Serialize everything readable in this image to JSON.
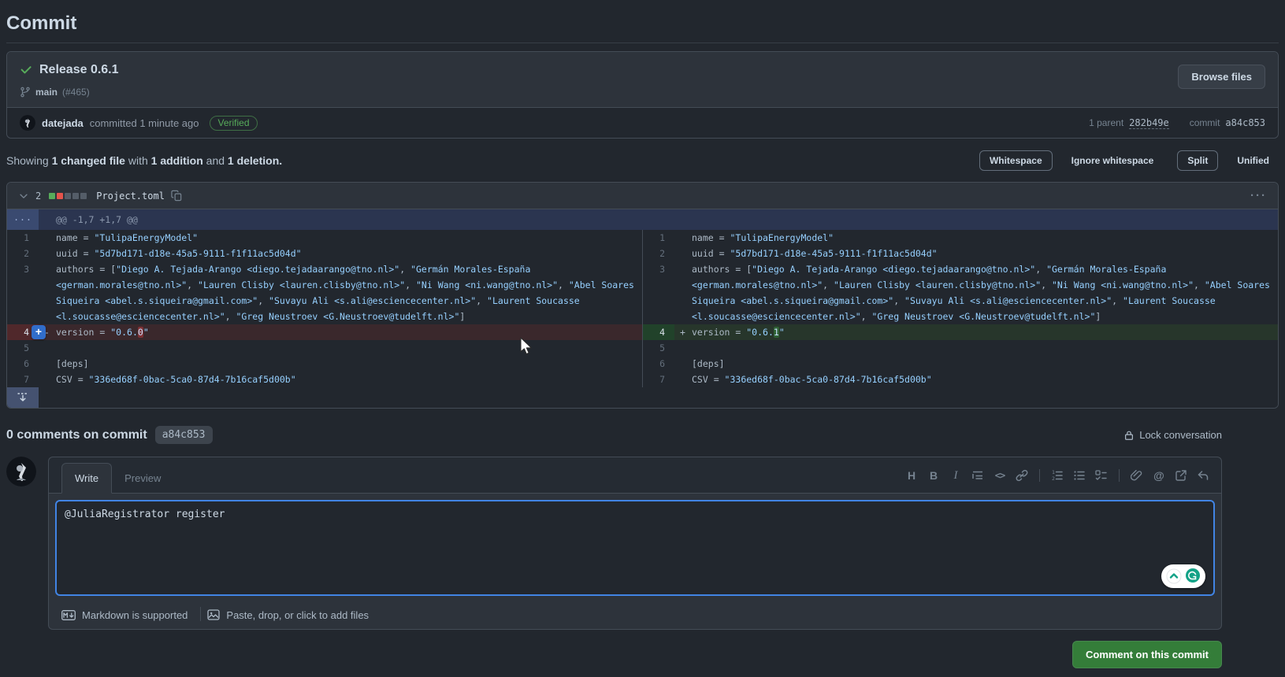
{
  "page": {
    "title": "Commit"
  },
  "commit_box": {
    "title": "Release 0.6.1",
    "branch": "main",
    "pr_ref": "(#465)",
    "browse_files_label": "Browse files",
    "author": "datejada",
    "committed_text": "committed 1 minute ago",
    "verified_label": "Verified",
    "parent_label": "1 parent",
    "parent_sha": "282b49e",
    "commit_label": "commit",
    "commit_sha": "a84c853"
  },
  "summary": {
    "showing": "Showing ",
    "changed_file": "1 changed file",
    "with": " with ",
    "addition": "1 addition",
    "and": " and ",
    "deletion": "1 deletion."
  },
  "diff_controls": {
    "whitespace": "Whitespace",
    "ignore_whitespace": "Ignore whitespace",
    "split": "Split",
    "unified": "Unified"
  },
  "file": {
    "changes_count": "2",
    "name": "Project.toml",
    "kebab": "···",
    "diffstat": [
      "add",
      "del",
      "neutral",
      "neutral",
      "neutral"
    ]
  },
  "diff": {
    "gutter_dots": "···",
    "hunk_header": "@@ -1,7 +1,7 @@",
    "rows": [
      {
        "num": "1",
        "type": "ctx",
        "segs": [
          {
            "t": "name = ",
            "c": "p"
          },
          {
            "t": "\"TulipaEnergyModel\"",
            "c": "s"
          }
        ]
      },
      {
        "num": "2",
        "type": "ctx",
        "segs": [
          {
            "t": "uuid = ",
            "c": "p"
          },
          {
            "t": "\"5d7bd171-d18e-45a5-9111-f1f11ac5d04d\"",
            "c": "s"
          }
        ]
      },
      {
        "num": "3",
        "type": "ctx",
        "segs": [
          {
            "t": "authors = [",
            "c": "p"
          },
          {
            "t": "\"Diego A. Tejada-Arango <diego.tejadaarango@tno.nl>\"",
            "c": "s"
          },
          {
            "t": ", ",
            "c": "p"
          },
          {
            "t": "\"Germán Morales-España <german.morales@tno.nl>\"",
            "c": "s"
          },
          {
            "t": ", ",
            "c": "p"
          },
          {
            "t": "\"Lauren Clisby <lauren.clisby@tno.nl>\"",
            "c": "s"
          },
          {
            "t": ", ",
            "c": "p"
          },
          {
            "t": "\"Ni Wang <ni.wang@tno.nl>\"",
            "c": "s"
          },
          {
            "t": ", ",
            "c": "p"
          },
          {
            "t": "\"Abel Soares Siqueira <abel.s.siqueira@gmail.com>\"",
            "c": "s"
          },
          {
            "t": ", ",
            "c": "p"
          },
          {
            "t": "\"Suvayu Ali <s.ali@esciencecenter.nl>\"",
            "c": "s"
          },
          {
            "t": ", ",
            "c": "p"
          },
          {
            "t": "\"Laurent Soucasse <l.soucasse@esciencecenter.nl>\"",
            "c": "s"
          },
          {
            "t": ", ",
            "c": "p"
          },
          {
            "t": "\"Greg Neustroev <G.Neustroev@tudelft.nl>\"",
            "c": "s"
          },
          {
            "t": "]",
            "c": "p"
          }
        ]
      },
      {
        "num": "4",
        "type": "change",
        "left": {
          "type": "del",
          "plus_button": true,
          "segs": [
            {
              "t": "version = ",
              "c": "p"
            },
            {
              "t": "\"0.6.",
              "c": "s"
            },
            {
              "t": "0",
              "c": "h"
            },
            {
              "t": "\"",
              "c": "s"
            }
          ]
        },
        "right": {
          "type": "add",
          "segs": [
            {
              "t": "version = ",
              "c": "p"
            },
            {
              "t": "\"0.6.",
              "c": "s"
            },
            {
              "t": "1",
              "c": "h"
            },
            {
              "t": "\"",
              "c": "s"
            }
          ]
        }
      },
      {
        "num": "5",
        "type": "ctx",
        "segs": []
      },
      {
        "num": "6",
        "type": "ctx",
        "segs": [
          {
            "t": "[deps]",
            "c": "p"
          }
        ]
      },
      {
        "num": "7",
        "type": "ctx",
        "segs": [
          {
            "t": "CSV = ",
            "c": "p"
          },
          {
            "t": "\"336ed68f-0bac-5ca0-87d4-7b16caf5d00b\"",
            "c": "s"
          }
        ]
      }
    ]
  },
  "comments": {
    "header": "0 comments on commit",
    "sha_badge": "a84c853",
    "lock_label": "Lock conversation"
  },
  "comment_form": {
    "tab_write": "Write",
    "tab_preview": "Preview",
    "textarea_value": "@JuliaRegistrator register",
    "toolbar_icons": [
      "heading",
      "bold",
      "italic",
      "quote",
      "code",
      "link",
      "numbered-list",
      "unordered-list",
      "task-list",
      "attach-file",
      "mention",
      "cross-reference",
      "saved-replies"
    ],
    "hint_markdown": "Markdown is supported",
    "hint_paste": "Paste, drop, or click to add files",
    "submit_label": "Comment on this commit"
  },
  "colors": {
    "background": "#22272e",
    "panel": "#2d333b",
    "border": "#444c56",
    "text_primary": "#cdd9e5",
    "text_muted": "#768390",
    "accent_blue": "#4184e4",
    "success_green": "#57ab5a",
    "button_green": "#347d39",
    "danger_red": "#e5534b",
    "code_string_blue": "#96d0ff"
  }
}
